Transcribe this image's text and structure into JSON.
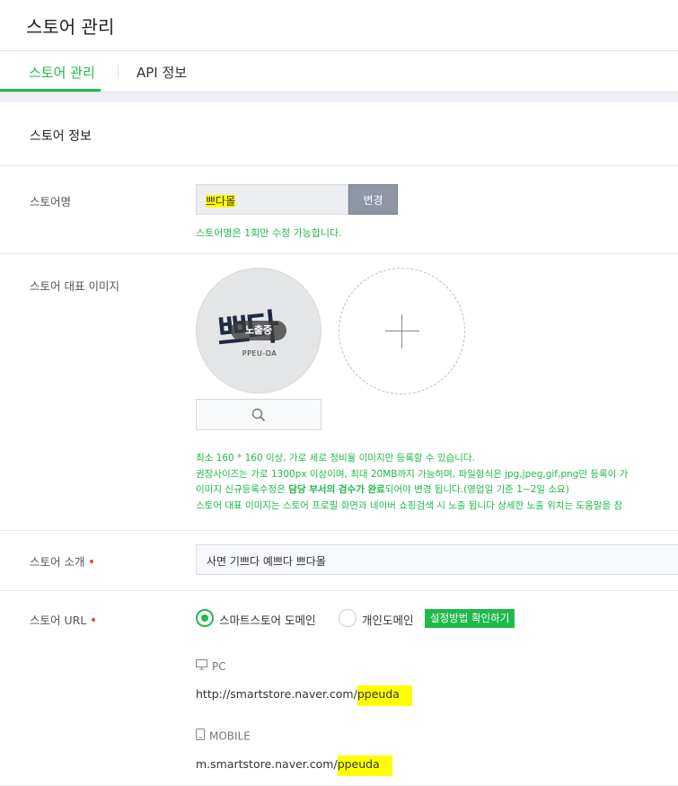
{
  "page": {
    "title": "스토어 관리"
  },
  "tabs": [
    {
      "label": "스토어 관리",
      "active": true
    },
    {
      "label": "API 정보",
      "active": false
    }
  ],
  "section": {
    "title": "스토어 정보"
  },
  "store_name": {
    "label": "스토어명",
    "value": "쁘다몰",
    "change_label": "변경",
    "note": "스토어명은 1회만 수정 가능합니다."
  },
  "store_image": {
    "label": "스토어 대표 이미지",
    "logo_script": "쁘다",
    "logo_sub": "PPEU-DA",
    "badge": "노출중",
    "notes": {
      "line1": "최소 160 * 160 이상, 가로 세로 정비율 이미지만 등록할 수 있습니다.",
      "line2": "권장사이즈는 가로 1300px 이상이며, 최대 20MB까지 가능하며, 파일형식은 jpg,jpeg,gif,png만 등록이 가",
      "line3_a": "이미지 신규등록수정은 ",
      "line3_b": "담당 부서의 검수가 완료",
      "line3_c": "되어야 변경 됩니다.(영업일 기준 1~2일 소요)",
      "line4": "스토어 대표 이미지는 스토어 프로필 화면과 네이버 쇼핑검색 시 노출 됩니다 상세한 노출 위치는 도움말을 참"
    }
  },
  "store_intro": {
    "label": "스토어 소개",
    "value": "사면 기쁘다 예쁘다 쁘다몰"
  },
  "store_url": {
    "label": "스토어 URL",
    "option_smartstore": "스마트스토어 도메인",
    "option_personal": "개인도메인",
    "guide_label": "설정방법 확인하기",
    "pc_label": "PC",
    "pc_url_prefix": "http://smartstore.naver.com/",
    "pc_url_slug": "ppeuda",
    "mobile_label": "MOBILE",
    "mobile_url_prefix": "m.smartstore.naver.com/",
    "mobile_url_slug": "ppeuda"
  },
  "colors": {
    "accent_green": "#1fba4a",
    "required_dot": "#f24343",
    "highlight": "#ffff00",
    "change_button": "#8e95a3"
  }
}
